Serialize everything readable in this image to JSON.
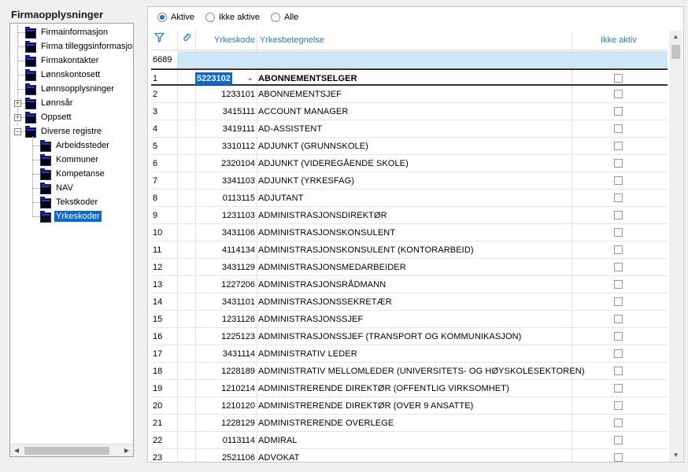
{
  "panel_title": "Firmaopplysninger",
  "tree": {
    "items": [
      {
        "label": "Firmainformasjon"
      },
      {
        "label": "Firma tilleggsinformasjon"
      },
      {
        "label": "Firmakontakter"
      },
      {
        "label": "Lønnskontosett"
      },
      {
        "label": "Lønnsopplysninger"
      },
      {
        "label": "Lønnsår",
        "expander": "+"
      },
      {
        "label": "Oppsett",
        "expander": "+"
      },
      {
        "label": "Diverse registre",
        "expander": "−"
      }
    ],
    "children": [
      {
        "label": "Arbeidssteder"
      },
      {
        "label": "Kommuner"
      },
      {
        "label": "Kompetanse"
      },
      {
        "label": "NAV"
      },
      {
        "label": "Tekstkoder"
      },
      {
        "label": "Yrkeskoder",
        "selected": true
      }
    ]
  },
  "filters": {
    "aktive": "Aktive",
    "ikke_aktive": "Ikke aktive",
    "alle": "Alle",
    "selected": "aktive"
  },
  "columns": {
    "code": "Yrkeskode",
    "name": "Yrkesbetegnelse",
    "inactive": "Ikke aktiv"
  },
  "filter_row_count": "6689",
  "active_row": {
    "num": "1",
    "code": "5223102",
    "name": "ABONNEMENTSELGER"
  },
  "rows": [
    {
      "num": "2",
      "code": "1233101",
      "name": "ABONNEMENTSJEF"
    },
    {
      "num": "3",
      "code": "3415111",
      "name": "ACCOUNT MANAGER"
    },
    {
      "num": "4",
      "code": "3419111",
      "name": "AD-ASSISTENT"
    },
    {
      "num": "5",
      "code": "3310112",
      "name": "ADJUNKT (GRUNNSKOLE)"
    },
    {
      "num": "6",
      "code": "2320104",
      "name": "ADJUNKT (VIDEREGÅENDE SKOLE)"
    },
    {
      "num": "7",
      "code": "3341103",
      "name": "ADJUNKT (YRKESFAG)"
    },
    {
      "num": "8",
      "code": "0113115",
      "name": "ADJUTANT"
    },
    {
      "num": "9",
      "code": "1231103",
      "name": "ADMINISTRASJONSDIREKTØR"
    },
    {
      "num": "10",
      "code": "3431106",
      "name": "ADMINISTRASJONSKONSULENT"
    },
    {
      "num": "11",
      "code": "4114134",
      "name": "ADMINISTRASJONSKONSULENT (KONTORARBEID)"
    },
    {
      "num": "12",
      "code": "3431129",
      "name": "ADMINISTRASJONSMEDARBEIDER"
    },
    {
      "num": "13",
      "code": "1227206",
      "name": "ADMINISTRASJONSRÅDMANN"
    },
    {
      "num": "14",
      "code": "3431101",
      "name": "ADMINISTRASJONSSEKRETÆR"
    },
    {
      "num": "15",
      "code": "1231126",
      "name": "ADMINISTRASJONSSJEF"
    },
    {
      "num": "16",
      "code": "1225123",
      "name": "ADMINISTRASJONSSJEF (TRANSPORT OG KOMMUNIKASJON)"
    },
    {
      "num": "17",
      "code": "3431114",
      "name": "ADMINISTRATIV LEDER"
    },
    {
      "num": "18",
      "code": "1228189",
      "name": "ADMINISTRATIV MELLOMLEDER (UNIVERSITETS- OG HØYSKOLESEKTOREN)"
    },
    {
      "num": "19",
      "code": "1210214",
      "name": "ADMINISTRERENDE DIREKTØR (OFFENTLIG VIRKSOMHET)"
    },
    {
      "num": "20",
      "code": "1210120",
      "name": "ADMINISTRERENDE DIREKTØR (OVER 9 ANSATTE)"
    },
    {
      "num": "21",
      "code": "1228129",
      "name": "ADMINISTRERENDE OVERLEGE"
    },
    {
      "num": "22",
      "code": "0113114",
      "name": "ADMIRAL"
    },
    {
      "num": "23",
      "code": "2521106",
      "name": "ADVOKAT"
    }
  ]
}
